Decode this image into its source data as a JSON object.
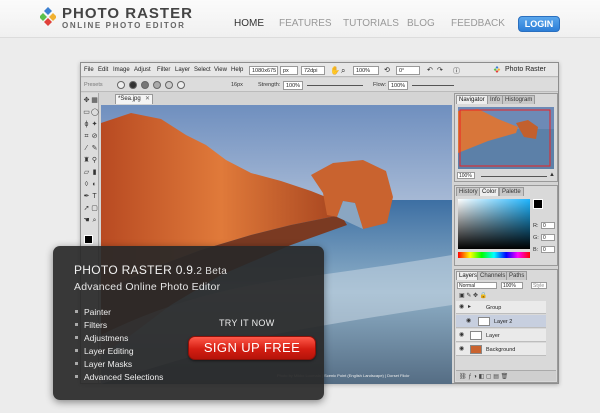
{
  "site": {
    "brand_name": "PHOTO RASTER",
    "brand_tagline": "ONLINE PHOTO EDITOR",
    "nav": [
      "HOME",
      "FEATURES",
      "TUTORIALS",
      "BLOG",
      "FEEDBACK"
    ],
    "nav_active": "HOME",
    "login": "LOGIN",
    "colors": {
      "login_button": "#3a8fe0",
      "signup_button": "#e0261a",
      "logo": [
        "#3b7fd1",
        "#5bbf4a",
        "#e0403a",
        "#f0b030"
      ]
    }
  },
  "app": {
    "menu": [
      "File",
      "Edit",
      "Image",
      "Adjust",
      "Filter",
      "Layer",
      "Select",
      "View",
      "Help"
    ],
    "size_w": "1080x675",
    "unit": "px",
    "dpi": "72dpi",
    "zoom": "100%",
    "angle": "0°",
    "app_title": "Photo Raster",
    "options": {
      "presets": "Presets",
      "size_label": "16px",
      "strength_label": "Strength:",
      "strength": "100%",
      "flow_label": "Flow:",
      "flow": "100%"
    },
    "document_tab": "*Sea.jpg",
    "caption": "Photo by Mikko Luomala | Scenic Point (English Landscape) | Dorset Flickr"
  },
  "panels": {
    "navigator_tabs": [
      "Navigator",
      "Info",
      "Histogram"
    ],
    "navigator_zoom": "100%",
    "color_tabs": [
      "History",
      "Color",
      "Palette"
    ],
    "rgb_labels": [
      "R:",
      "G:",
      "B:"
    ],
    "rgb_values": [
      "0",
      "0",
      "0"
    ],
    "layers_tabs": [
      "Layers",
      "Channels",
      "Paths"
    ],
    "blend_mode": "Normal",
    "opacity": "100%",
    "style": "Style",
    "layers": [
      {
        "name": "Group",
        "kind": "group"
      },
      {
        "name": "Layer 2",
        "kind": "layer",
        "selected": true
      },
      {
        "name": "Layer",
        "kind": "layer"
      },
      {
        "name": "Background",
        "kind": "image"
      }
    ]
  },
  "promo": {
    "title": "PHOTO RASTER 0.9",
    "version_small": ".2 Beta",
    "subtitle": "Advanced Online Photo Editor",
    "features": [
      "Painter",
      "Filters",
      "Adjustmens",
      "Layer Editing",
      "Layer Masks",
      "Advanced Selections"
    ],
    "try_now": "TRY IT NOW",
    "signup": "SIGN UP FREE"
  }
}
